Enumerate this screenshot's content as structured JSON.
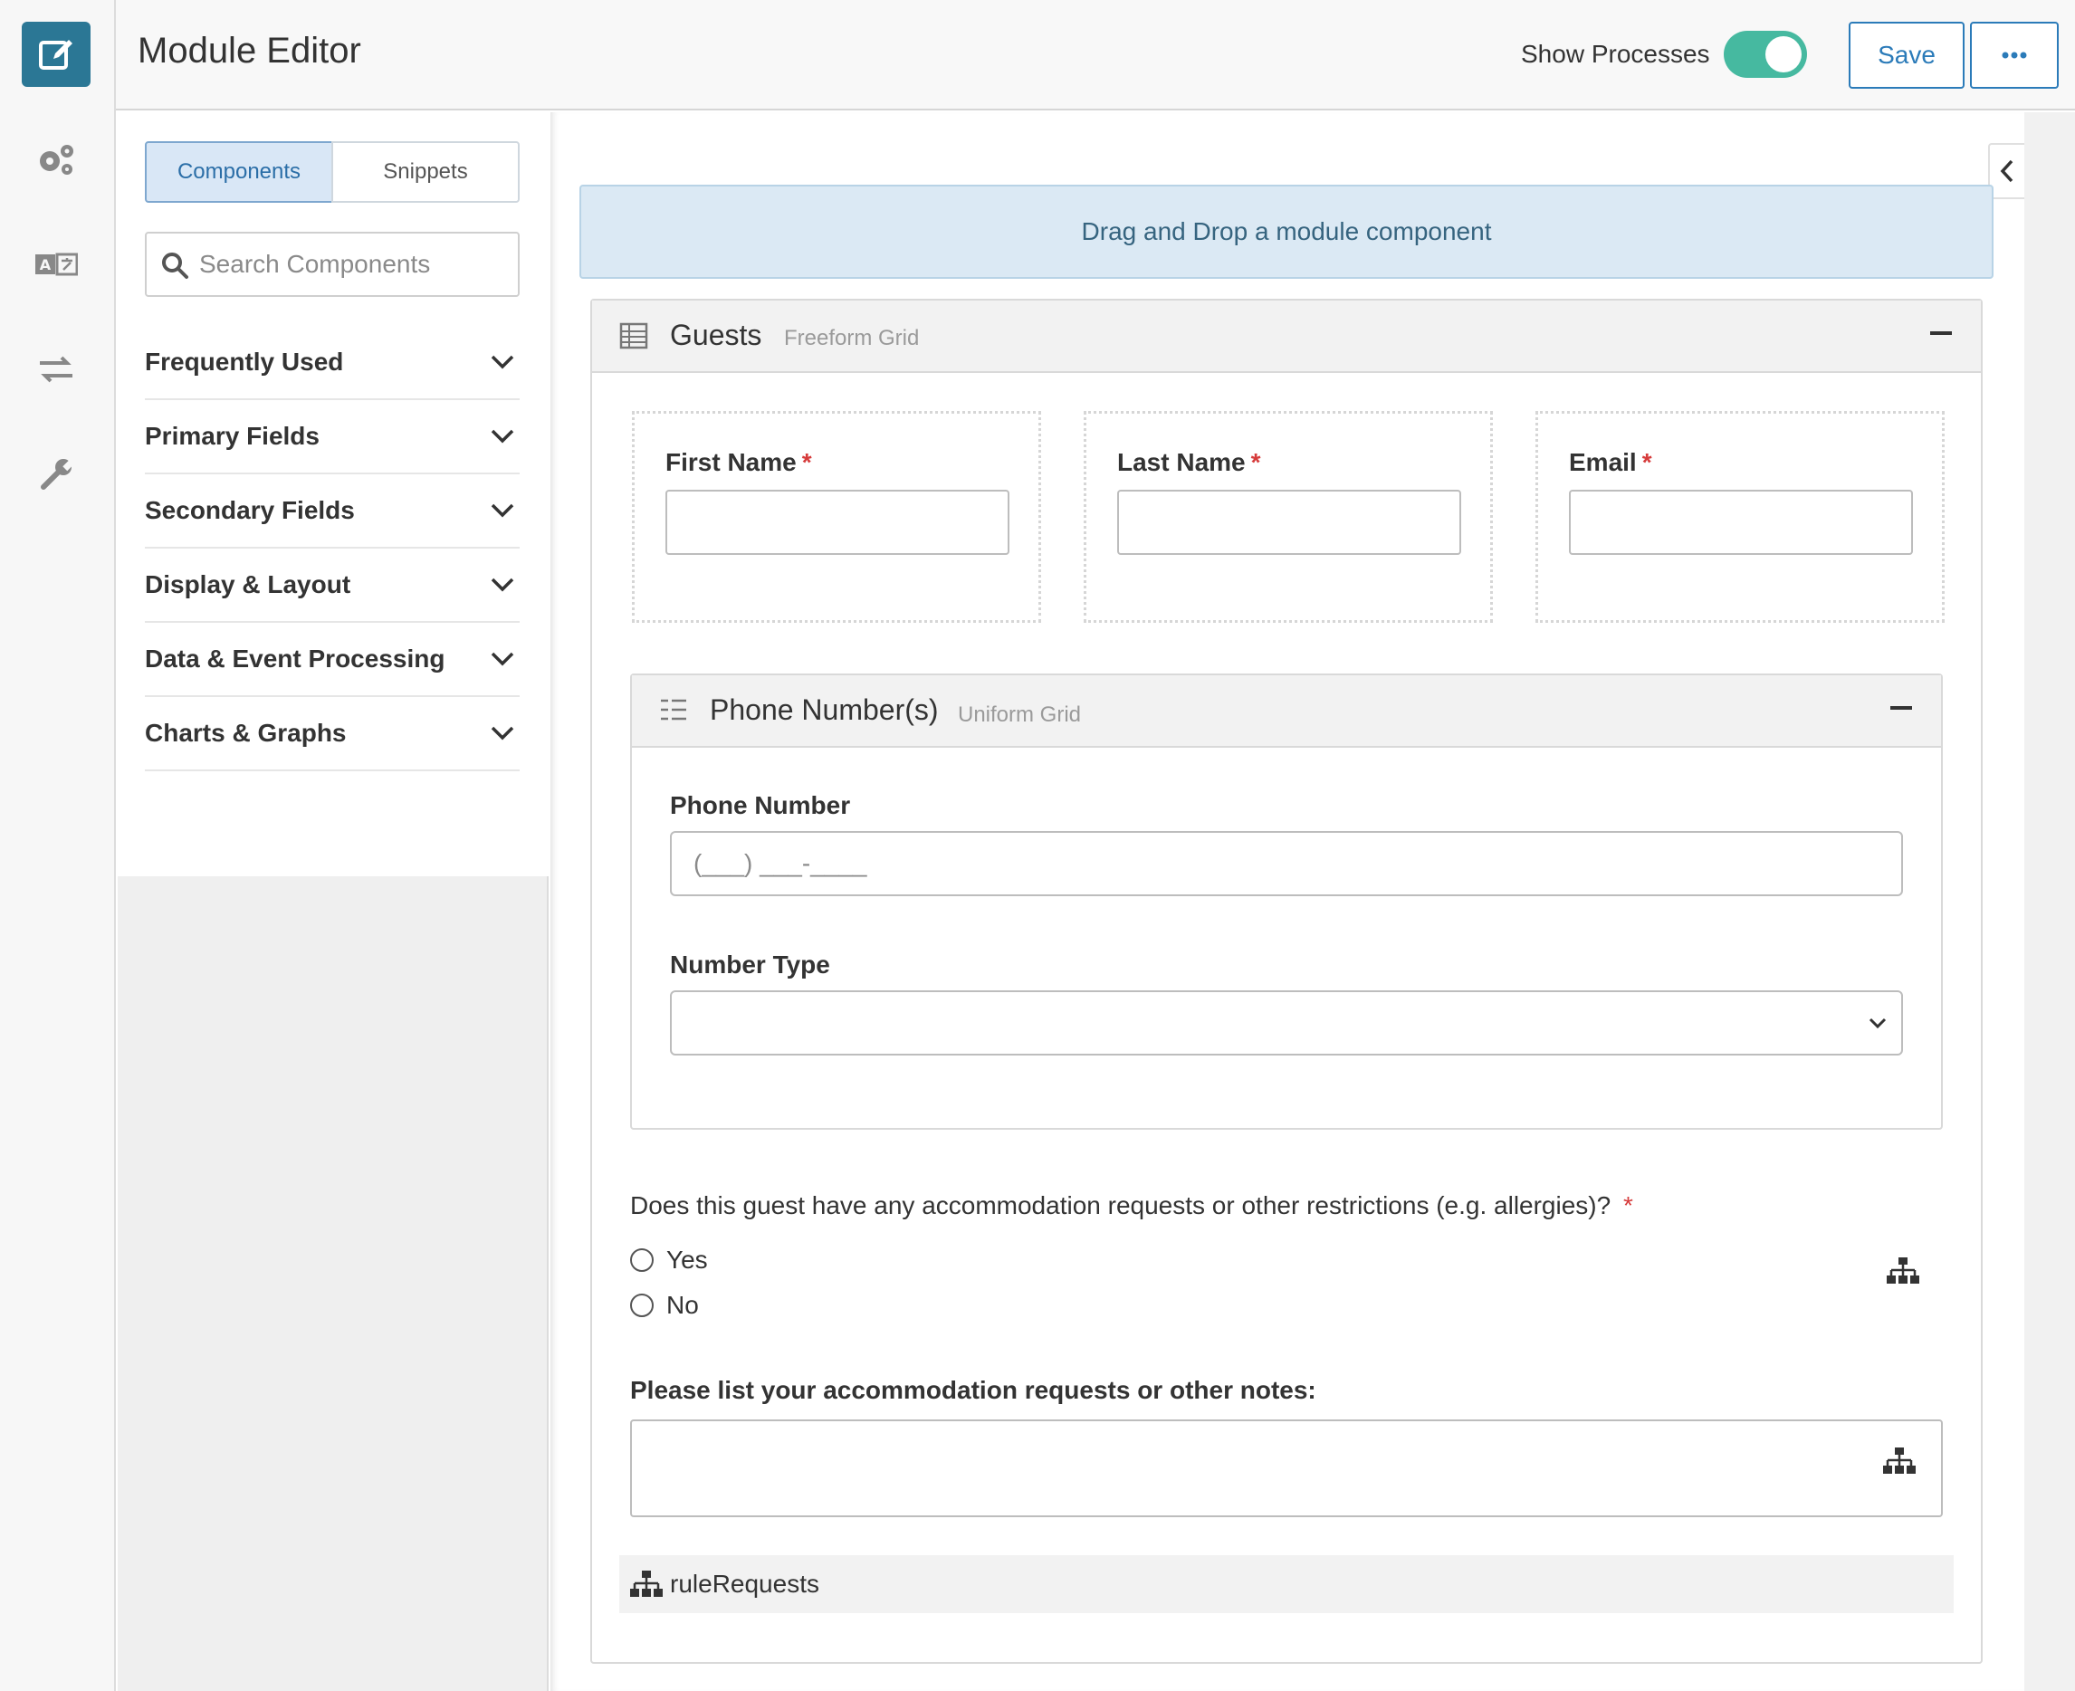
{
  "header": {
    "title": "Module Editor",
    "show_processes_label": "Show Processes",
    "show_processes_on": true,
    "save_label": "Save",
    "more_label": "•••"
  },
  "rail": {
    "items": [
      "edit-icon",
      "settings-icon",
      "translate-icon",
      "swap-icon",
      "wrench-icon"
    ]
  },
  "sidebar": {
    "tabs": [
      "Components",
      "Snippets"
    ],
    "active_tab": "Components",
    "search_placeholder": "Search Components",
    "categories": [
      "Frequently Used",
      "Primary Fields",
      "Secondary Fields",
      "Display & Layout",
      "Data & Event Processing",
      "Charts & Graphs"
    ]
  },
  "canvas": {
    "dropzone_text": "Drag and Drop a module component",
    "guests": {
      "title": "Guests",
      "type": "Freeform Grid",
      "fields": [
        {
          "label": "First Name",
          "required": "*"
        },
        {
          "label": "Last Name",
          "required": "*"
        },
        {
          "label": "Email",
          "required": "*"
        }
      ],
      "phone": {
        "title": "Phone Number(s)",
        "type": "Uniform Grid",
        "phone_label": "Phone Number",
        "phone_mask": "(___) ___-____",
        "number_type_label": "Number Type",
        "number_type_value": ""
      },
      "question": "Does this guest have any accommodation requests or other restrictions (e.g. allergies)?",
      "question_required": "*",
      "options": [
        "Yes",
        "No"
      ],
      "notes_label": "Please list your accommodation requests or other notes:",
      "rule_name": "ruleRequests"
    }
  },
  "colors": {
    "accent": "#2b7795",
    "toggle_on": "#46b9a0",
    "button_border": "#2b7bb9",
    "required": "#d63b3b",
    "dropzone_bg": "#dbe9f4"
  }
}
